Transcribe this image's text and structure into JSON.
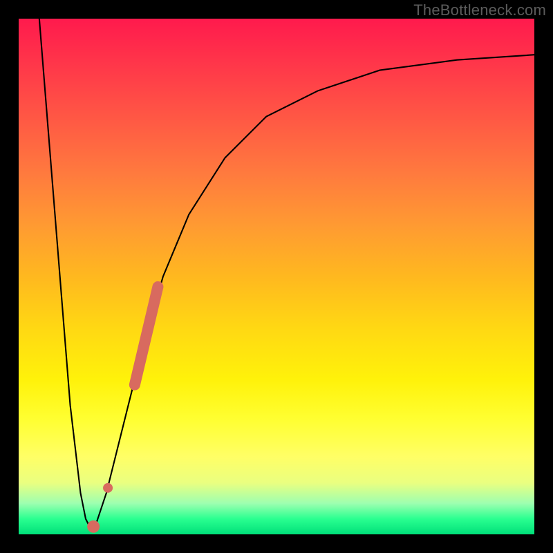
{
  "watermark": "TheBottleneck.com",
  "chart_data": {
    "type": "line",
    "title": "",
    "xlabel": "",
    "ylabel": "",
    "xlim": [
      0,
      100
    ],
    "ylim": [
      0,
      100
    ],
    "grid": false,
    "legend": false,
    "series": [
      {
        "name": "curve",
        "color": "#000000",
        "type": "line",
        "points": [
          {
            "x": 4,
            "y": 100
          },
          {
            "x": 6,
            "y": 75
          },
          {
            "x": 8,
            "y": 50
          },
          {
            "x": 10,
            "y": 25
          },
          {
            "x": 12,
            "y": 8
          },
          {
            "x": 13,
            "y": 3
          },
          {
            "x": 14,
            "y": 1
          },
          {
            "x": 15,
            "y": 2
          },
          {
            "x": 17,
            "y": 8
          },
          {
            "x": 20,
            "y": 20
          },
          {
            "x": 24,
            "y": 36
          },
          {
            "x": 28,
            "y": 50
          },
          {
            "x": 33,
            "y": 62
          },
          {
            "x": 40,
            "y": 73
          },
          {
            "x": 48,
            "y": 81
          },
          {
            "x": 58,
            "y": 86
          },
          {
            "x": 70,
            "y": 90
          },
          {
            "x": 85,
            "y": 92
          },
          {
            "x": 100,
            "y": 93
          }
        ]
      },
      {
        "name": "highlight-segment",
        "color": "#d86a5f",
        "type": "thick-line",
        "points": [
          {
            "x": 22.5,
            "y": 29
          },
          {
            "x": 27,
            "y": 48
          }
        ]
      },
      {
        "name": "highlight-point-upper",
        "color": "#d86a5f",
        "type": "point",
        "points": [
          {
            "x": 17.3,
            "y": 9
          }
        ]
      },
      {
        "name": "highlight-point-lower",
        "color": "#d86a5f",
        "type": "point",
        "points": [
          {
            "x": 14.5,
            "y": 1.5
          }
        ]
      }
    ],
    "gradient_bands": [
      {
        "y": 100,
        "color": "#ff1a4d"
      },
      {
        "y": 50,
        "color": "#ffb81f"
      },
      {
        "y": 20,
        "color": "#ffff33"
      },
      {
        "y": 5,
        "color": "#9dffb0"
      },
      {
        "y": 0,
        "color": "#00e07a"
      }
    ]
  }
}
